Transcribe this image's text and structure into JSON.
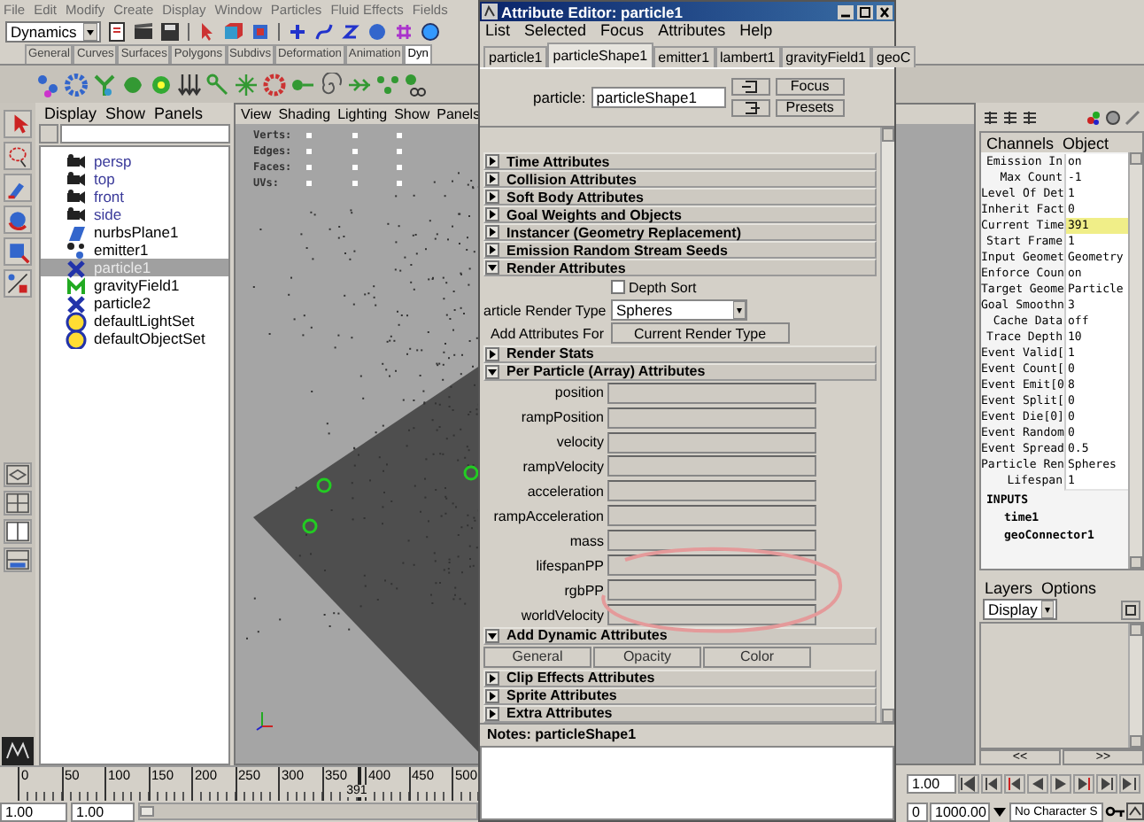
{
  "menu_bar": [
    "File",
    "Edit",
    "Modify",
    "Create",
    "Display",
    "Window",
    "Particles",
    "Fluid Effects",
    "Fields"
  ],
  "menu_set": "Dynamics",
  "shelf_tabs": [
    {
      "label": "General",
      "selected": false
    },
    {
      "label": "Curves",
      "selected": false
    },
    {
      "label": "Surfaces",
      "selected": false
    },
    {
      "label": "Polygons",
      "selected": false
    },
    {
      "label": "Subdivs",
      "selected": false
    },
    {
      "label": "Deformation",
      "selected": false
    },
    {
      "label": "Animation",
      "selected": false
    },
    {
      "label": "Dyn",
      "selected": true
    }
  ],
  "outliner": {
    "menu": [
      "Display",
      "Show",
      "Panels"
    ],
    "items": [
      {
        "label": "persp",
        "kind": "camera",
        "selected": false
      },
      {
        "label": "top",
        "kind": "camera",
        "selected": false
      },
      {
        "label": "front",
        "kind": "camera",
        "selected": false
      },
      {
        "label": "side",
        "kind": "camera",
        "selected": false
      },
      {
        "label": "nurbsPlane1",
        "kind": "surface",
        "selected": false
      },
      {
        "label": "emitter1",
        "kind": "emitter",
        "selected": false
      },
      {
        "label": "particle1",
        "kind": "particle",
        "selected": true
      },
      {
        "label": "gravityField1",
        "kind": "field",
        "selected": false
      },
      {
        "label": "particle2",
        "kind": "particle",
        "selected": false
      },
      {
        "label": "defaultLightSet",
        "kind": "set",
        "selected": false
      },
      {
        "label": "defaultObjectSet",
        "kind": "set",
        "selected": false
      }
    ]
  },
  "viewport": {
    "menu": [
      "View",
      "Shading",
      "Lighting",
      "Show",
      "Panels"
    ],
    "hud": [
      "Verts:",
      "Edges:",
      "Faces:",
      "UVs:"
    ]
  },
  "channel_box": {
    "menu": [
      "Channels",
      "Object"
    ],
    "rows": [
      {
        "name": "Emission In",
        "value": "on",
        "highlighted": false
      },
      {
        "name": "Max Count",
        "value": "-1",
        "highlighted": false
      },
      {
        "name": "Level Of Det",
        "value": "1",
        "highlighted": false
      },
      {
        "name": "Inherit Fact",
        "value": "0",
        "highlighted": false
      },
      {
        "name": "Current Time",
        "value": "391",
        "highlighted": true
      },
      {
        "name": "Start Frame",
        "value": "1",
        "highlighted": false
      },
      {
        "name": "Input Geomet",
        "value": "Geometry",
        "highlighted": false
      },
      {
        "name": "Enforce Coun",
        "value": "on",
        "highlighted": false
      },
      {
        "name": "Target Geome",
        "value": "Particle",
        "highlighted": false
      },
      {
        "name": "Goal Smoothn",
        "value": "3",
        "highlighted": false
      },
      {
        "name": "Cache Data",
        "value": "off",
        "highlighted": false
      },
      {
        "name": "Trace Depth",
        "value": "10",
        "highlighted": false
      },
      {
        "name": "Event Valid[",
        "value": "1",
        "highlighted": false
      },
      {
        "name": "Event Count[",
        "value": "0",
        "highlighted": false
      },
      {
        "name": "Event Emit[0",
        "value": "8",
        "highlighted": false
      },
      {
        "name": "Event Split[",
        "value": "0",
        "highlighted": false
      },
      {
        "name": "Event Die[0]",
        "value": "0",
        "highlighted": false
      },
      {
        "name": "Event Random",
        "value": "0",
        "highlighted": false
      },
      {
        "name": "Event Spread",
        "value": "0.5",
        "highlighted": false
      },
      {
        "name": "Particle Ren",
        "value": "Spheres",
        "highlighted": false
      },
      {
        "name": "Lifespan",
        "value": "1",
        "highlighted": false
      }
    ],
    "inputs_title": "INPUTS",
    "inputs": [
      "time1",
      "geoConnector1"
    ]
  },
  "layers": {
    "menu": [
      "Layers",
      "Options"
    ],
    "display": "Display",
    "nav": [
      "<<",
      ">>"
    ]
  },
  "time_slider": {
    "ticks": [
      "0",
      "50",
      "100",
      "150",
      "200",
      "250",
      "300",
      "350",
      "400",
      "450",
      "500"
    ],
    "current_frame": "391",
    "level": 0.782,
    "current_time": "1.00"
  },
  "range_slider": {
    "level": 0,
    "start_time": "1.00",
    "range_start": "1.00",
    "range_end": "0",
    "end_time": "1000.00",
    "character_set": "No Character S"
  },
  "attribute_editor": {
    "title": "Attribute Editor: particle1",
    "menu": [
      "List",
      "Selected",
      "Focus",
      "Attributes",
      "Help"
    ],
    "tabs": [
      {
        "label": "particle1",
        "selected": false
      },
      {
        "label": "particleShape1",
        "selected": true
      },
      {
        "label": "emitter1",
        "selected": false
      },
      {
        "label": "lambert1",
        "selected": false
      },
      {
        "label": "gravityField1",
        "selected": false
      },
      {
        "label": "geoC",
        "selected": false
      }
    ],
    "node_label": "particle:",
    "node_value": "particleShape1",
    "buttons": [
      "Focus",
      "Presets"
    ],
    "sections": [
      {
        "title": "Time Attributes",
        "expanded": false
      },
      {
        "title": "Collision Attributes",
        "expanded": false
      },
      {
        "title": "Soft Body Attributes",
        "expanded": false
      },
      {
        "title": "Goal Weights and Objects",
        "expanded": false
      },
      {
        "title": "Instancer (Geometry Replacement)",
        "expanded": false
      },
      {
        "title": "Emission Random Stream Seeds",
        "expanded": false
      },
      {
        "title": "Render Attributes",
        "kind": "render",
        "expanded": true,
        "depth_sort": {
          "label": "Depth Sort",
          "checked": false
        },
        "render_type": {
          "label": "article Render Type",
          "value": "Spheres"
        },
        "add_attributes": {
          "label": "Add Attributes For",
          "button": "Current Render Type"
        }
      },
      {
        "title": "Render Stats",
        "expanded": false
      },
      {
        "title": "Per Particle (Array) Attributes",
        "kind": "fields",
        "expanded": true,
        "fields": [
          "position",
          "rampPosition",
          "velocity",
          "rampVelocity",
          "acceleration",
          "rampAcceleration",
          "mass",
          "lifespanPP",
          "rgbPP",
          "worldVelocity"
        ]
      },
      {
        "title": "Add Dynamic Attributes",
        "kind": "buttons",
        "expanded": true,
        "buttons": [
          "General",
          "Opacity",
          "Color"
        ]
      },
      {
        "title": "Clip Effects Attributes",
        "expanded": false
      },
      {
        "title": "Sprite Attributes",
        "expanded": false
      },
      {
        "title": "Extra Attributes",
        "expanded": false
      }
    ],
    "notes_title": "Notes: particleShape1"
  }
}
